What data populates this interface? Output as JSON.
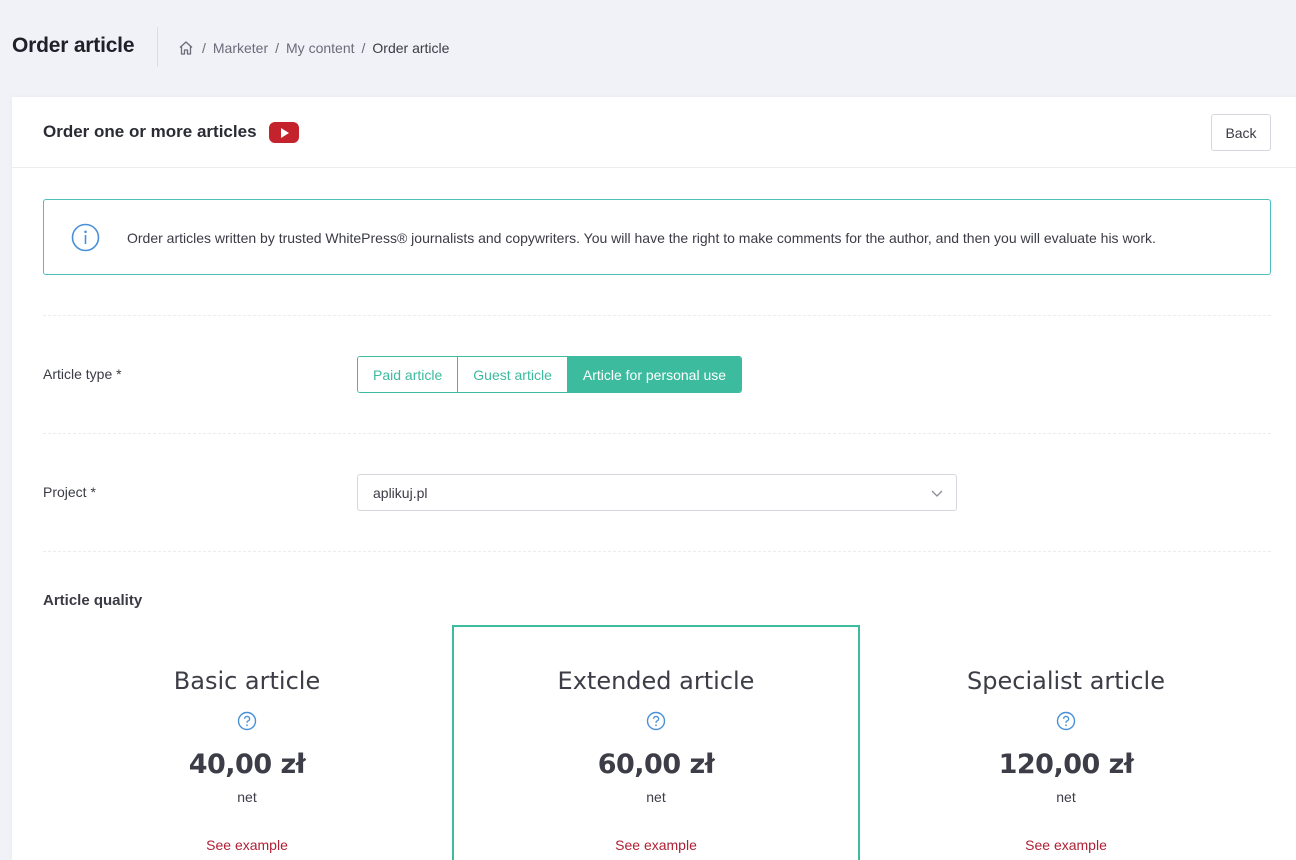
{
  "header": {
    "title": "Order article",
    "breadcrumb": [
      {
        "label": "Marketer"
      },
      {
        "label": "My content"
      },
      {
        "label": "Order article"
      }
    ]
  },
  "card": {
    "title": "Order one or more articles",
    "back_label": "Back",
    "info_text": "Order articles written by trusted WhitePress® journalists and copywriters. You will have the right to make comments for the author, and then you will evaluate his work."
  },
  "article_type": {
    "label": "Article type *",
    "options": [
      {
        "label": "Paid article",
        "active": false
      },
      {
        "label": "Guest article",
        "active": false
      },
      {
        "label": "Article for personal use",
        "active": true
      }
    ]
  },
  "project": {
    "label": "Project *",
    "value": "aplikuj.pl"
  },
  "quality": {
    "title": "Article quality",
    "items": [
      {
        "name": "Basic article",
        "price": "40,00 zł",
        "net": "net",
        "example": "See example",
        "selected": false
      },
      {
        "name": "Extended article",
        "price": "60,00 zł",
        "net": "net",
        "example": "See example",
        "selected": true
      },
      {
        "name": "Specialist article",
        "price": "120,00 zł",
        "net": "net",
        "example": "See example",
        "selected": false
      }
    ]
  },
  "colors": {
    "accent": "#3dbb9e",
    "info_border": "#4fbfbb",
    "link_red": "#b02035",
    "youtube_red": "#c4232e",
    "info_icon_blue": "#4a90d9"
  }
}
